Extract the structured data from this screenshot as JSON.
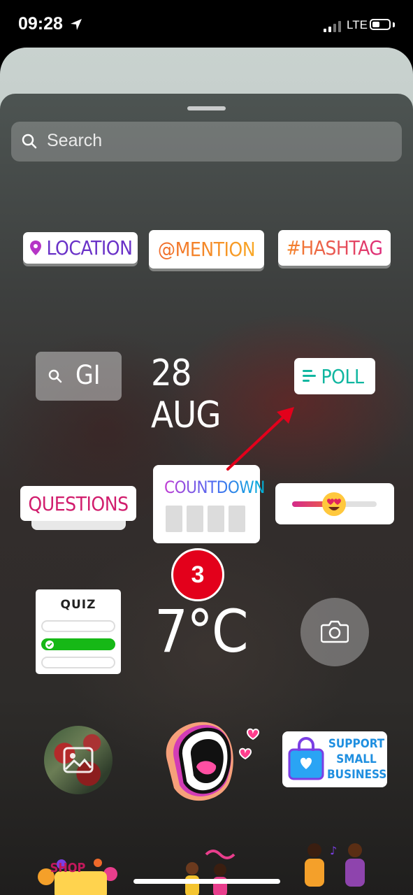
{
  "status_bar": {
    "time": "09:28",
    "network": "LTE"
  },
  "search": {
    "placeholder": "Search"
  },
  "stickers": {
    "location": "LOCATION",
    "mention": "@MENTION",
    "hashtag": "#HASHTAG",
    "gif": "GI",
    "date": "28 AUG",
    "poll": "POLL",
    "questions": "QUESTIONS",
    "countdown": "COUNTDOWN",
    "quiz": "QUIZ",
    "temperature": "7°C",
    "support": "SUPPORT SMALL BUSINESS",
    "shop": "SHOP"
  },
  "annotation": {
    "step_number": "3",
    "badge_color": "#e3001b"
  },
  "icons": [
    "location-arrow-icon",
    "signal-icon",
    "battery-icon",
    "search-icon",
    "pin-icon",
    "poll-lines-icon",
    "heart-eyes-emoji-icon",
    "camera-icon",
    "image-icon",
    "mouth-icon",
    "shopping-bag-icon"
  ]
}
